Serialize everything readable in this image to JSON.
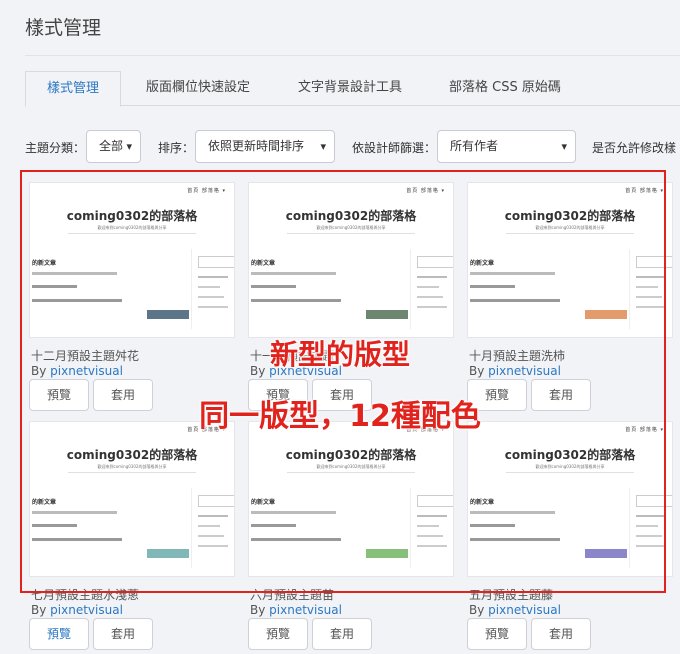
{
  "header": {
    "title": "樣式管理"
  },
  "tabs": [
    {
      "label": "樣式管理",
      "active": true
    },
    {
      "label": "版面欄位快速設定",
      "active": false
    },
    {
      "label": "文字背景設計工具",
      "active": false
    },
    {
      "label": "部落格 CSS 原始碼",
      "active": false
    }
  ],
  "filters": {
    "category_label": "主題分類：",
    "category_value": "全部",
    "sort_label": "排序：",
    "sort_value": "依照更新時間排序",
    "designer_label": "依設計師篩選：",
    "designer_value": "所有作者",
    "allow_label": "是否允許修改樣"
  },
  "thumbnail": {
    "nav": "首頁 部落格 ▾",
    "blog_title": "coming0302的部落格",
    "subtitle": "歡迎來到coming0302的部落格與分享",
    "section": "的新文章"
  },
  "cards": [
    {
      "name": "十二月預設主題舛花",
      "author_prefix": "By",
      "author": "pixnetvisual",
      "preview": "預覽",
      "apply": "套用",
      "accent": "#5d7588"
    },
    {
      "name": "十一月預設主題",
      "author_prefix": "By",
      "author": "pixnetvisual",
      "preview": "預覽",
      "apply": "套用",
      "accent": "#6d8670"
    },
    {
      "name": "十月預設主題洗柿",
      "author_prefix": "By",
      "author": "pixnetvisual",
      "preview": "預覽",
      "apply": "套用",
      "accent": "#e39a6d"
    },
    {
      "name": "七月預設主題水淺蔥",
      "author_prefix": "By",
      "author": "pixnetvisual",
      "preview": "預覽",
      "apply": "套用",
      "accent": "#7fb8b6"
    },
    {
      "name": "六月預設主題苗",
      "author_prefix": "By",
      "author": "pixnetvisual",
      "preview": "預覽",
      "apply": "套用",
      "accent": "#86c07a"
    },
    {
      "name": "五月預設主題藤",
      "author_prefix": "By",
      "author": "pixnetvisual",
      "preview": "預覽",
      "apply": "套用",
      "accent": "#8a86c9"
    }
  ],
  "annotation": {
    "line1": "新型的版型",
    "line2": "同一版型，12種配色"
  }
}
